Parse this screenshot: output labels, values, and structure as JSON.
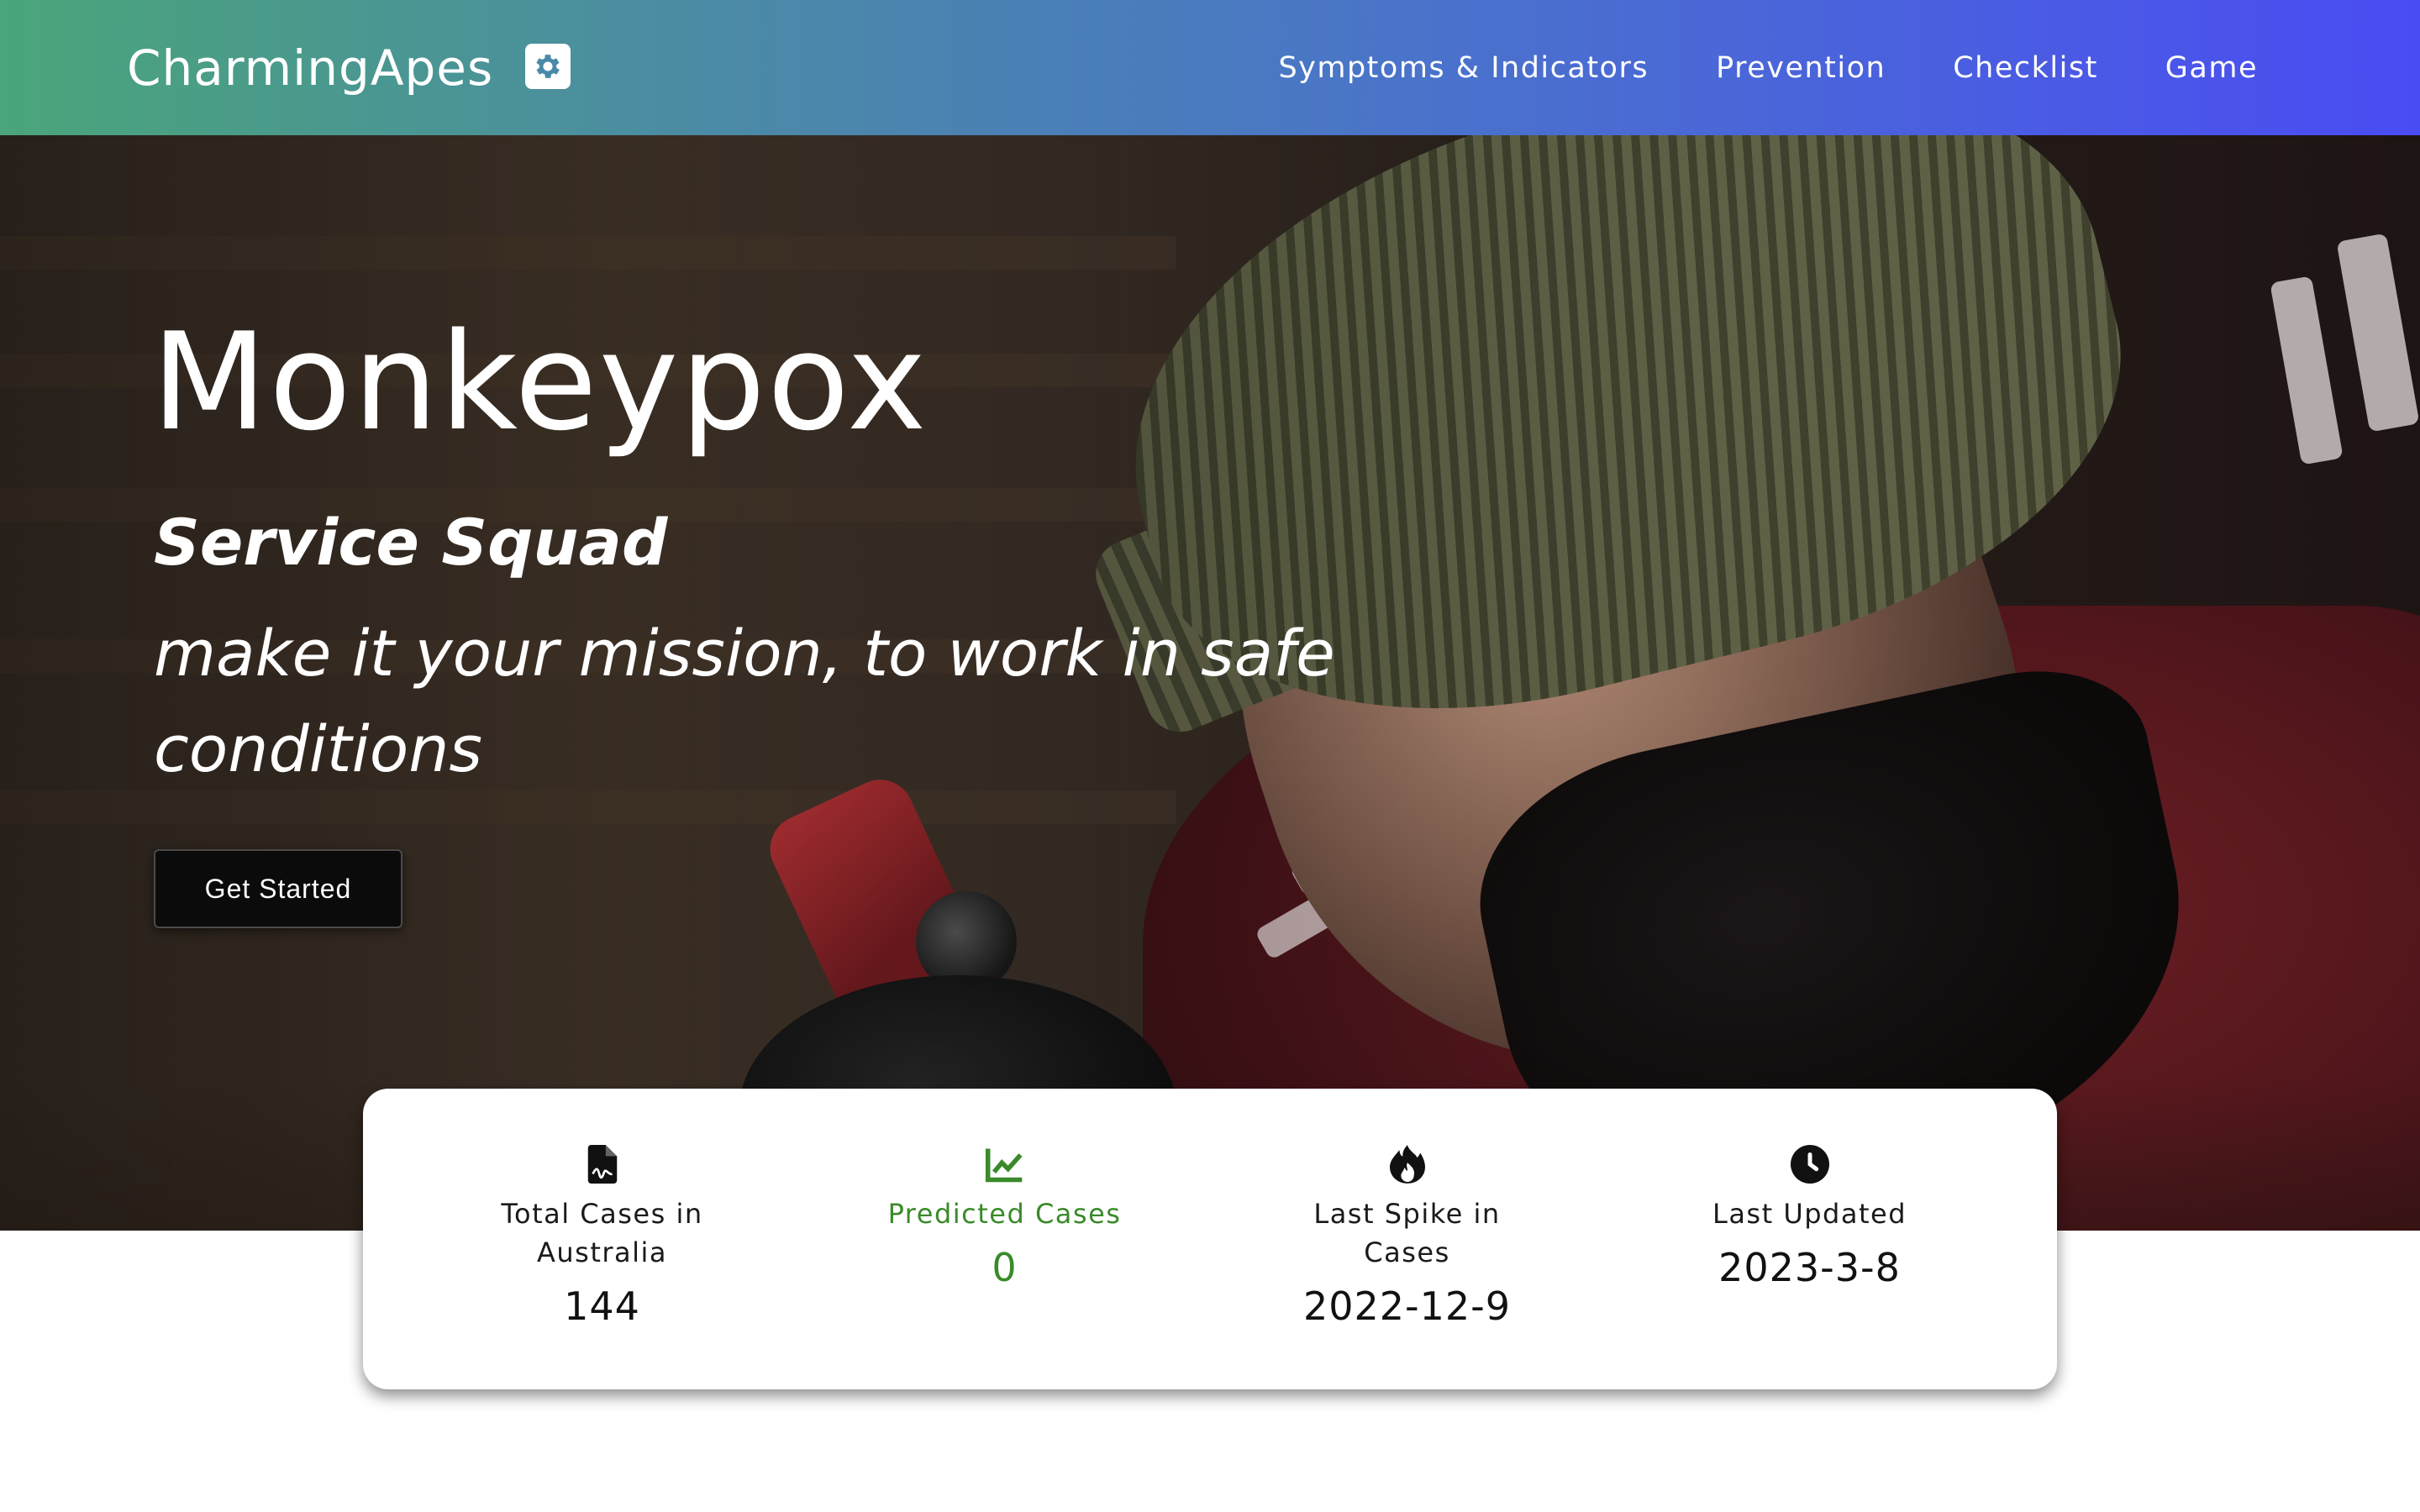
{
  "nav": {
    "brand": "CharmingApes",
    "brand_icon": "gear-icon",
    "links": [
      "Symptoms & Indicators",
      "Prevention",
      "Checklist",
      "Game"
    ]
  },
  "hero": {
    "title": "Monkeypox",
    "subtitle": "Service Squad",
    "tagline": "make it your mission, to work in safe conditions",
    "cta_label": "Get Started"
  },
  "stats": [
    {
      "icon": "file-chart-icon",
      "label": "Total Cases in Australia",
      "value": "144"
    },
    {
      "icon": "line-chart-icon",
      "label": "Predicted Cases",
      "value": "0",
      "color": "#3a8a2a"
    },
    {
      "icon": "fire-icon",
      "label": "Last Spike in Cases",
      "value": "2022-12-9"
    },
    {
      "icon": "clock-icon",
      "label": "Last Updated",
      "value": "2023-3-8"
    }
  ],
  "colors": {
    "nav_gradient_start": "#4aa57a",
    "nav_gradient_end": "#4a4cf3",
    "accent_green": "#3a8a2a"
  }
}
